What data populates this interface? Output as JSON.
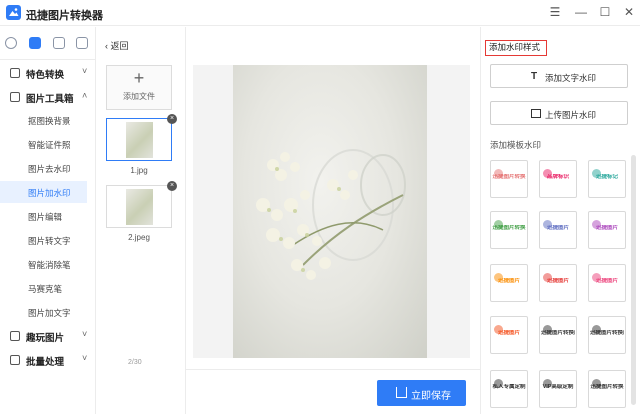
{
  "app": {
    "title": "迅捷图片转换器"
  },
  "window_controls": {
    "menu": "☰",
    "minimize": "—",
    "maximize": "☐",
    "close": "✕"
  },
  "sidebar": {
    "groups": [
      {
        "label": "特色转换",
        "expanded": false
      },
      {
        "label": "图片工具箱",
        "expanded": true
      },
      {
        "label": "趣玩图片",
        "expanded": false
      },
      {
        "label": "批量处理",
        "expanded": false
      }
    ],
    "items": [
      {
        "label": "抠图换背景"
      },
      {
        "label": "智能证件照"
      },
      {
        "label": "图片去水印"
      },
      {
        "label": "图片加水印",
        "active": true
      },
      {
        "label": "图片编辑"
      },
      {
        "label": "图片转文字"
      },
      {
        "label": "智能消除笔"
      },
      {
        "label": "马赛克笔"
      },
      {
        "label": "图片加文字"
      }
    ],
    "chevron_right": "›",
    "chevron_down": "˅"
  },
  "file_panel": {
    "back_label": "‹ 返回",
    "add_file_label": "添加文件",
    "add_icon": "+",
    "files": [
      {
        "name": "1.jpg",
        "selected": true
      },
      {
        "name": "2.jpeg",
        "selected": false
      }
    ],
    "remove_icon": "×",
    "page_indicator": "2/30"
  },
  "save_button": {
    "label": "立即保存"
  },
  "right_panel": {
    "style_title": "添加水印样式",
    "add_text_label": "添加文字水印",
    "add_text_icon": "T",
    "upload_image_label": "上传图片水印",
    "template_title": "添加模板水印",
    "templates": [
      {
        "text": "迅捷图片转换",
        "color": "#e57373"
      },
      {
        "text": "品牌标识",
        "color": "#e91e63"
      },
      {
        "text": "迅捷标记",
        "color": "#26a69a"
      },
      {
        "text": "迅捷图片转换",
        "color": "#43a047"
      },
      {
        "text": "迅捷图片",
        "color": "#5c6bc0"
      },
      {
        "text": "迅捷图片",
        "color": "#ab47bc"
      },
      {
        "text": "迅捷图片",
        "color": "#fb8c00"
      },
      {
        "text": "迅捷图片",
        "color": "#e53935"
      },
      {
        "text": "迅捷图片",
        "color": "#ec407a"
      },
      {
        "text": "迅捷图片",
        "color": "#f4511e"
      },
      {
        "text": "迅捷图片转换器 xunjie",
        "color": "#333333"
      },
      {
        "text": "迅捷图片转换器 xunjie",
        "color": "#333333"
      },
      {
        "text": "私人专属定制",
        "color": "#333333"
      },
      {
        "text": "VIP高级定制",
        "color": "#333333"
      },
      {
        "text": "迅捷图片转换",
        "color": "#333333"
      }
    ]
  },
  "accent": "#2f7cf6"
}
